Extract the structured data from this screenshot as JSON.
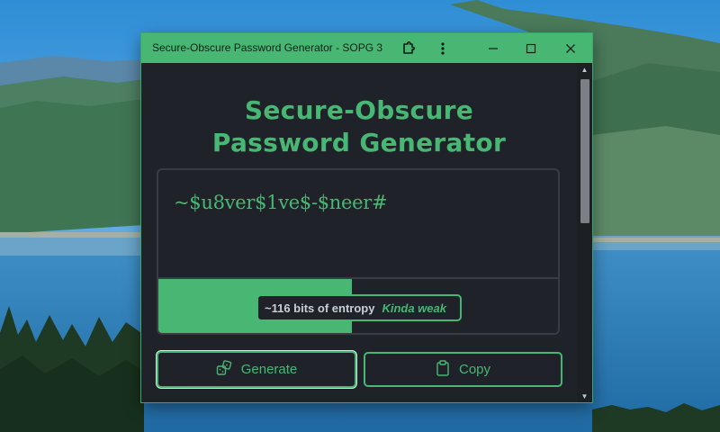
{
  "window": {
    "title": "Secure-Obscure Password Generator - SOPG 3",
    "controls": [
      "extension-icon",
      "kebab-menu-icon",
      "minimize-icon",
      "maximize-icon",
      "close-icon"
    ]
  },
  "app": {
    "title_line1": "Secure-Obscure",
    "title_line2": "Password Generator",
    "password": "~$u8ver$1ve$-$neer#",
    "strength": {
      "entropy_label": "~116 bits of entropy",
      "rating": "Kinda weak",
      "fill_fraction": 0.485
    },
    "buttons": {
      "generate_label": "Generate",
      "generate_icon": "generate-dice-icon",
      "copy_label": "Copy",
      "copy_icon": "clipboard-icon"
    }
  },
  "colors": {
    "accent": "#48b774",
    "background": "#1f2329",
    "border": "#373c44"
  }
}
